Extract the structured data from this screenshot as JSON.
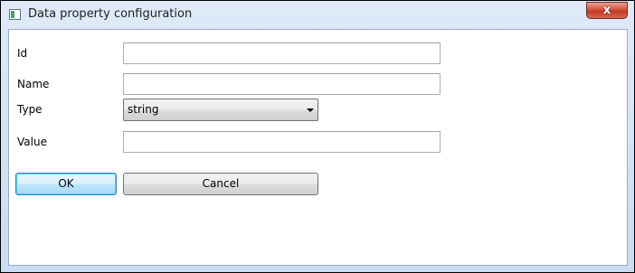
{
  "window": {
    "title": "Data property configuration",
    "close_glyph": "x",
    "app_icon": "window-app-icon"
  },
  "form": {
    "id_label": "Id",
    "id_value": "",
    "name_label": "Name",
    "name_value": "",
    "type_label": "Type",
    "type_value": "string",
    "value_label": "Value",
    "value_value": ""
  },
  "buttons": {
    "ok_label": "OK",
    "cancel_label": "Cancel"
  },
  "colors": {
    "ok_border": "#3c7fb1",
    "close_button": "#c33a25"
  }
}
